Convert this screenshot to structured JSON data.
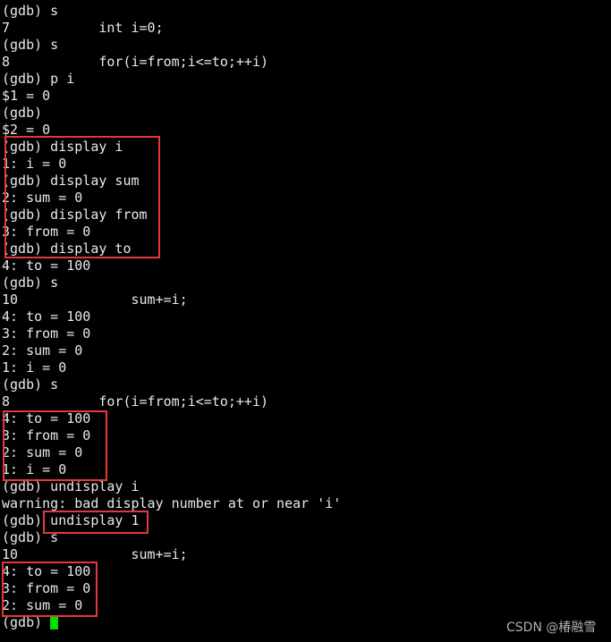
{
  "terminal": {
    "lines": [
      "(gdb) s",
      "7           int i=0;",
      "(gdb) s",
      "8           for(i=from;i<=to;++i)",
      "(gdb) p i",
      "$1 = 0",
      "(gdb)",
      "$2 = 0",
      "(gdb) display i",
      "1: i = 0",
      "(gdb) display sum",
      "2: sum = 0",
      "(gdb) display from",
      "3: from = 0",
      "(gdb) display to",
      "4: to = 100",
      "(gdb) s",
      "10              sum+=i;",
      "4: to = 100",
      "3: from = 0",
      "2: sum = 0",
      "1: i = 0",
      "(gdb) s",
      "8           for(i=from;i<=to;++i)",
      "4: to = 100",
      "3: from = 0",
      "2: sum = 0",
      "1: i = 0",
      "(gdb) undisplay i",
      "warning: bad display number at or near 'i'",
      "(gdb) undisplay 1",
      "(gdb) s",
      "10              sum+=i;",
      "4: to = 100",
      "3: from = 0",
      "2: sum = 0"
    ],
    "prompt": "(gdb) ",
    "cursor_color": "#00e000",
    "highlight_color": "#e8373a"
  },
  "watermark": "CSDN @椿融雪"
}
